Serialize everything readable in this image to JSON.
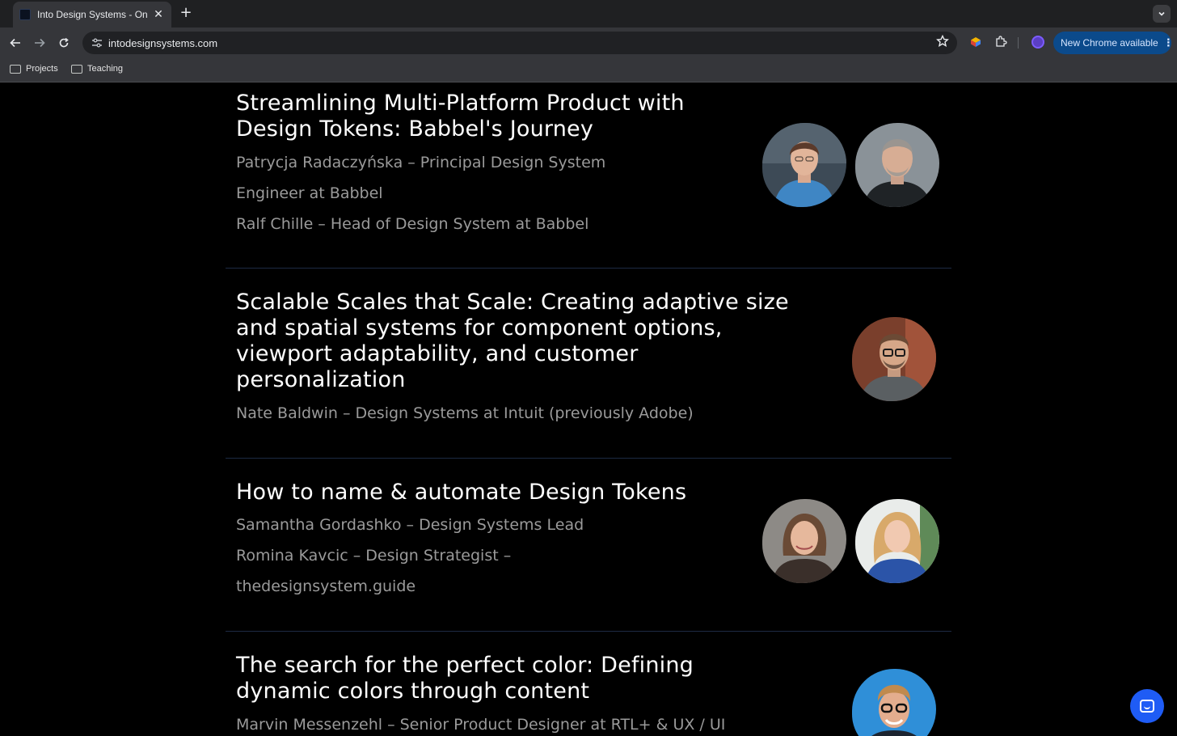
{
  "browser": {
    "tab_title": "Into Design Systems - Online",
    "tab_close_glyph": "✕",
    "new_tab_glyph": "+",
    "url": "intodesignsystems.com",
    "update_label": "New Chrome available",
    "bookmarks": [
      {
        "label": "Projects"
      },
      {
        "label": "Teaching"
      }
    ]
  },
  "talks": [
    {
      "title_lines": [
        "Streamlining Multi-Platform Product with",
        "Design Tokens: Babbel's Journey"
      ],
      "speaker_lines": [
        "Patrycja Radaczyńska – Principal Design System",
        "Engineer at Babbel",
        "Ralf Chille – Head of Design System at Babbel"
      ],
      "avatars": 2
    },
    {
      "title_lines": [
        "Scalable Scales that Scale: Creating adaptive size",
        "and spatial systems for component options,",
        "viewport adaptability, and customer",
        "personalization"
      ],
      "speaker_lines": [
        "Nate Baldwin – Design Systems at Intuit (previously Adobe)"
      ],
      "avatars": 1
    },
    {
      "title_lines": [
        "How to name & automate Design Tokens"
      ],
      "speaker_lines": [
        "Samantha Gordashko – Design Systems Lead",
        "Romina Kavcic – Design Strategist –",
        "thedesignsystem.guide"
      ],
      "avatars": 2
    },
    {
      "title_lines": [
        "The search for the perfect color: Defining",
        "dynamic colors through content"
      ],
      "speaker_lines": [
        "Marvin Messenzehl – Senior Product Designer at RTL+ & UX / UI"
      ],
      "avatars": 1
    }
  ],
  "colors": {
    "page_bg": "#000000",
    "title": "#ffffff",
    "speaker": "#9a9a9a",
    "divider": "#1d2a44",
    "chat_button": "#1f5cf5"
  }
}
